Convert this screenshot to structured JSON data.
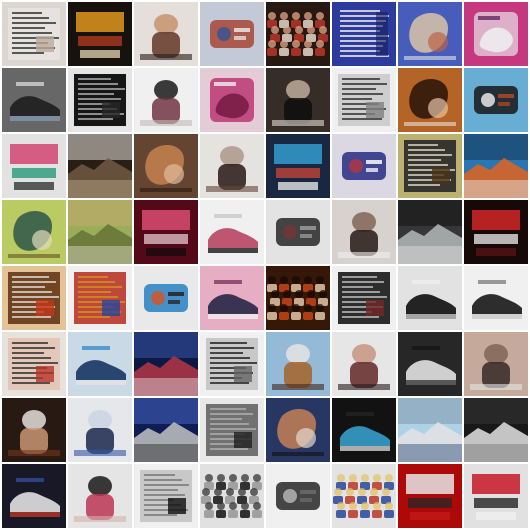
{
  "grid": {
    "rows": 8,
    "cols": 8,
    "tiles": [
      {
        "bg": "#e9e4dd",
        "a": "#c8b8a6",
        "b": "#2b2b2b",
        "c": "#f5f2ee",
        "motif": "document"
      },
      {
        "bg": "#1a1410",
        "a": "#f0a020",
        "b": "#c04020",
        "c": "#e9d7b0",
        "motif": "poster"
      },
      {
        "bg": "#f3ede8",
        "a": "#6a3b2a",
        "b": "#d29b78",
        "c": "#2a1c18",
        "motif": "figure"
      },
      {
        "bg": "#d0d6e4",
        "a": "#b44b3a",
        "b": "#3a5a9a",
        "c": "#f1efe8",
        "motif": "product"
      },
      {
        "bg": "#2a1a14",
        "a": "#f2e6d8",
        "b": "#c43a2a",
        "c": "#f0b090",
        "motif": "crowd"
      },
      {
        "bg": "#2f3fa6",
        "a": "#e8e8f2",
        "b": "#1b2367",
        "c": "#ffffff",
        "motif": "text-blue"
      },
      {
        "bg": "#4c63c7",
        "a": "#e8d1b1",
        "b": "#c86a4a",
        "c": "#f3f0ee",
        "motif": "blob"
      },
      {
        "bg": "#d23b86",
        "a": "#f3e6ef",
        "b": "#6b2a6a",
        "c": "#ffffff",
        "motif": "pink"
      },
      {
        "bg": "#6e6e6e",
        "a": "#202020",
        "b": "#8aa0b8",
        "c": "#f0f0f0",
        "motif": "shoe"
      },
      {
        "bg": "#f4f4f4",
        "a": "#2a2a2a",
        "b": "#bfbfbf",
        "c": "#000000",
        "motif": "document"
      },
      {
        "bg": "#ffffff",
        "a": "#7b3a4a",
        "b": "#1c1c1c",
        "c": "#d0c7c2",
        "motif": "figure"
      },
      {
        "bg": "#f3d9e4",
        "a": "#c2246e",
        "b": "#ffffff",
        "c": "#7a1c45",
        "motif": "pink"
      },
      {
        "bg": "#3a2f2b",
        "a": "#0f0f0f",
        "b": "#c9b7a6",
        "c": "#f2e9df",
        "motif": "figure"
      },
      {
        "bg": "#ffffff",
        "a": "#8a8a8a",
        "b": "#2b2b2b",
        "c": "#d7d7d7",
        "motif": "document"
      },
      {
        "bg": "#c06b2a",
        "a": "#2a140a",
        "b": "#f3d2b0",
        "c": "#f7f1e9",
        "motif": "blob"
      },
      {
        "bg": "#6fb8e2",
        "a": "#1a1a1a",
        "b": "#f4f4f4",
        "c": "#b24a2a",
        "motif": "product"
      },
      {
        "bg": "#f1f1f1",
        "a": "#e04a7a",
        "b": "#1b9d7a",
        "c": "#3a3a3a",
        "motif": "poster"
      },
      {
        "bg": "#2b2016",
        "a": "#7a6046",
        "b": "#c9b59c",
        "c": "#f1efe8",
        "motif": "landscape"
      },
      {
        "bg": "#6b4a36",
        "a": "#d28b52",
        "b": "#f0c9a6",
        "c": "#2a1a12",
        "motif": "blob"
      },
      {
        "bg": "#f4f2ef",
        "a": "#2a1a16",
        "b": "#b7a294",
        "c": "#6a4a3e",
        "motif": "figure"
      },
      {
        "bg": "#1c2a44",
        "a": "#36a6dc",
        "b": "#d84a3a",
        "c": "#f2f2f2",
        "motif": "poster"
      },
      {
        "bg": "#e9e6f2",
        "a": "#2a2f8a",
        "b": "#b83a4a",
        "c": "#ffffff",
        "motif": "product"
      },
      {
        "bg": "#c9bd7a",
        "a": "#4c3a1a",
        "b": "#f2ead2",
        "c": "#2a2a2a",
        "motif": "document"
      },
      {
        "bg": "#2b7fbf",
        "a": "#f06a20",
        "b": "#ffffff",
        "c": "#1a3a5a",
        "motif": "landscape"
      },
      {
        "bg": "#c7d86a",
        "a": "#2f5c4e",
        "b": "#f1e9c7",
        "c": "#6b5a2a",
        "motif": "blob"
      },
      {
        "bg": "#a5b85c",
        "a": "#6b7a3a",
        "b": "#f5eeda",
        "c": "#d2b47a",
        "motif": "landscape"
      },
      {
        "bg": "#5a0a1a",
        "a": "#e8527a",
        "b": "#f4d4de",
        "c": "#1a0a10",
        "motif": "poster"
      },
      {
        "bg": "#ffffff",
        "a": "#c44a6a",
        "b": "#1a1a1a",
        "c": "#d0d0d0",
        "motif": "shoe"
      },
      {
        "bg": "#f2f2f2",
        "a": "#2a2a2a",
        "b": "#7a3a3a",
        "c": "#a0a0a0",
        "motif": "product"
      },
      {
        "bg": "#e5e0db",
        "a": "#2a1b18",
        "b": "#8a6b5a",
        "c": "#ffffff",
        "motif": "figure"
      },
      {
        "bg": "#3a3a3a",
        "a": "#bfc6c7",
        "b": "#f0f0f0",
        "c": "#141414",
        "motif": "landscape"
      },
      {
        "bg": "#1a0a0a",
        "a": "#e02a2a",
        "b": "#ffffff",
        "c": "#5a1414",
        "motif": "poster"
      },
      {
        "bg": "#f3d1a0",
        "a": "#d23a1a",
        "b": "#f5efe5",
        "c": "#6b3a1a",
        "motif": "document"
      },
      {
        "bg": "#ffffff",
        "a": "#2a4aa6",
        "b": "#e0a020",
        "c": "#c43a2a",
        "motif": "document"
      },
      {
        "bg": "#f8f8f8",
        "a": "#2a8ad0",
        "b": "#e05a2a",
        "c": "#2a2a2a",
        "motif": "product"
      },
      {
        "bg": "#f6b8cf",
        "a": "#2a2a4a",
        "b": "#ffffff",
        "c": "#7a2a5a",
        "motif": "shoe"
      },
      {
        "bg": "#3a1a0a",
        "a": "#d24a1a",
        "b": "#f0d2b2",
        "c": "#1a0a06",
        "motif": "crowd"
      },
      {
        "bg": "#ffffff",
        "a": "#7a2a2a",
        "b": "#cfcfcf",
        "c": "#1a1a1a",
        "motif": "document"
      },
      {
        "bg": "#f1f1f1",
        "a": "#0f0f0f",
        "b": "#a0a0a0",
        "c": "#ffffff",
        "motif": "shoe"
      },
      {
        "bg": "#ffffff",
        "a": "#1a1a1a",
        "b": "#d7d7d7",
        "c": "#7a7a7a",
        "motif": "shoe"
      },
      {
        "bg": "#f6f1ea",
        "a": "#c23a2a",
        "b": "#2a2a2a",
        "c": "#f2d0c0",
        "motif": "document"
      },
      {
        "bg": "#d7e7f5",
        "a": "#1a3a6a",
        "b": "#f2f2f2",
        "c": "#2a8ad0",
        "motif": "shoe"
      },
      {
        "bg": "#0e1b4a",
        "a": "#c03a4a",
        "b": "#f2f2f2",
        "c": "#3a5ab0",
        "motif": "landscape"
      },
      {
        "bg": "#ffffff",
        "a": "#6a6a6a",
        "b": "#1a1a1a",
        "c": "#d0d0d0",
        "motif": "document"
      },
      {
        "bg": "#9fc6e6",
        "a": "#b06a2a",
        "b": "#f2f2f2",
        "c": "#4a2a1a",
        "motif": "figure"
      },
      {
        "bg": "#f5f5f5",
        "a": "#6a2a2a",
        "b": "#d2a08a",
        "c": "#2a1a1a",
        "motif": "figure"
      },
      {
        "bg": "#2a2a2a",
        "a": "#f0f0f0",
        "b": "#6a6a6a",
        "c": "#141414",
        "motif": "shoe"
      },
      {
        "bg": "#d2b5a6",
        "a": "#3a2a2a",
        "b": "#8a6b5a",
        "c": "#f3f3f3",
        "motif": "figure"
      },
      {
        "bg": "#2b1c14",
        "a": "#d6a07a",
        "b": "#f3efe9",
        "c": "#7a3a1a",
        "motif": "figure"
      },
      {
        "bg": "#f4f6f9",
        "a": "#1c2a54",
        "b": "#d9e2f2",
        "c": "#3a5ab0",
        "motif": "figure"
      },
      {
        "bg": "#0f1f5a",
        "a": "#d0d0d0",
        "b": "#2a2a2a",
        "c": "#4a6ad0",
        "motif": "landscape"
      },
      {
        "bg": "#f7f7f7",
        "a": "#222222",
        "b": "#bdbdbd",
        "c": "#6a6a6a",
        "motif": "document"
      },
      {
        "bg": "#2a3a6a",
        "a": "#d08a5a",
        "b": "#f2e6dc",
        "c": "#121212",
        "motif": "blob"
      },
      {
        "bg": "#141414",
        "a": "#3aa6d6",
        "b": "#e0e0e0",
        "c": "#2a2a2a",
        "motif": "shoe"
      },
      {
        "bg": "#b8dff4",
        "a": "#f2f2f2",
        "b": "#2a4a7a",
        "c": "#8aa0b8",
        "motif": "landscape"
      },
      {
        "bg": "#1a1a1a",
        "a": "#f2f2f2",
        "b": "#7a7a7a",
        "c": "#3a3a3a",
        "motif": "landscape"
      },
      {
        "bg": "#1a1a2a",
        "a": "#f0f0f0",
        "b": "#c43a2a",
        "c": "#3a5ab0",
        "motif": "shoe"
      },
      {
        "bg": "#f4f4f4",
        "a": "#c83a5a",
        "b": "#1a1a1a",
        "c": "#e0c0b0",
        "motif": "figure"
      },
      {
        "bg": "#ffffff",
        "a": "#0f0f0f",
        "b": "#7a7a7a",
        "c": "#d0d0d0",
        "motif": "document"
      },
      {
        "bg": "#f0f0f0",
        "a": "#141414",
        "b": "#a0a0a0",
        "c": "#3a3a3a",
        "motif": "crowd"
      },
      {
        "bg": "#ffffff",
        "a": "#2a2a2a",
        "b": "#bfbfbf",
        "c": "#707070",
        "motif": "product"
      },
      {
        "bg": "#f2f2f2",
        "a": "#c43a2a",
        "b": "#2a4aa6",
        "c": "#f0d070",
        "motif": "crowd"
      },
      {
        "bg": "#b80a0a",
        "a": "#f4f4f4",
        "b": "#2a2a2a",
        "c": "#d21a1a",
        "motif": "poster"
      },
      {
        "bg": "#f0f0f0",
        "a": "#d41a2a",
        "b": "#1a1a1a",
        "c": "#ffffff",
        "motif": "poster"
      }
    ]
  }
}
